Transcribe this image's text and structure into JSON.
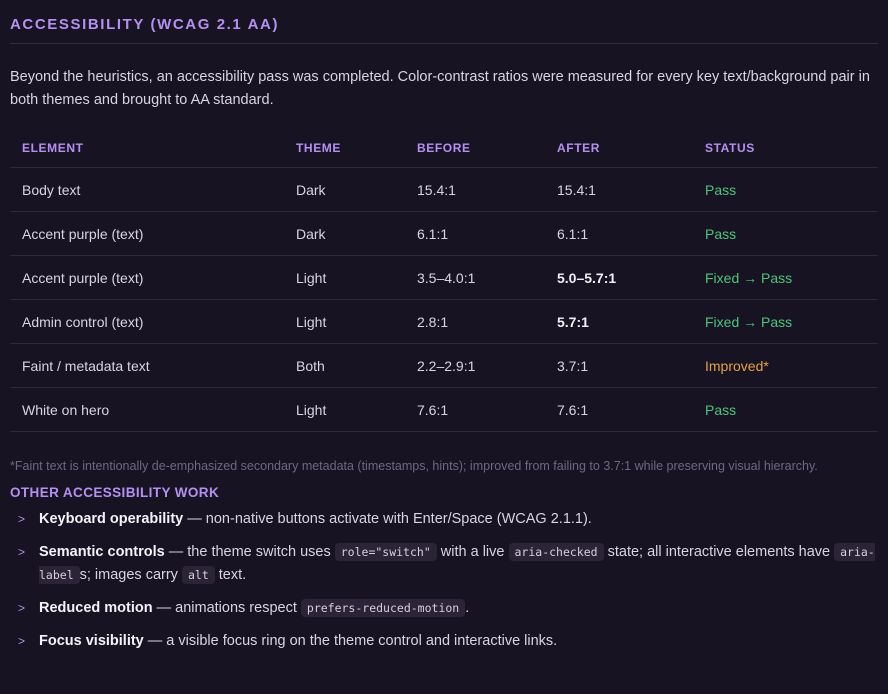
{
  "section_title": "ACCESSIBILITY (WCAG 2.1 AA)",
  "intro": "Beyond the heuristics, an accessibility pass was completed. Color-contrast ratios were measured for every key text/background pair in both themes and brought to AA standard.",
  "table": {
    "headers": [
      "ELEMENT",
      "THEME",
      "BEFORE",
      "AFTER",
      "STATUS"
    ],
    "rows": [
      {
        "element": "Body text",
        "theme": "Dark",
        "before": "15.4:1",
        "after": "15.4:1",
        "status": "Pass",
        "kind": "pass",
        "after_bold": false
      },
      {
        "element": "Accent purple (text)",
        "theme": "Dark",
        "before": "6.1:1",
        "after": "6.1:1",
        "status": "Pass",
        "kind": "pass",
        "after_bold": false
      },
      {
        "element": "Accent purple (text)",
        "theme": "Light",
        "before": "3.5–4.0:1",
        "after": "5.0–5.7:1",
        "status": "Fixed → Pass",
        "kind": "pass",
        "after_bold": true
      },
      {
        "element": "Admin control (text)",
        "theme": "Light",
        "before": "2.8:1",
        "after": "5.7:1",
        "status": "Fixed → Pass",
        "kind": "pass",
        "after_bold": true
      },
      {
        "element": "Faint / metadata text",
        "theme": "Both",
        "before": "2.2–2.9:1",
        "after": "3.7:1",
        "status": "Improved*",
        "kind": "warn",
        "after_bold": false
      },
      {
        "element": "White on hero",
        "theme": "Light",
        "before": "7.6:1",
        "after": "7.6:1",
        "status": "Pass",
        "kind": "pass",
        "after_bold": false
      }
    ]
  },
  "footnote": "*Faint text is intentionally de-emphasized secondary metadata (timestamps, hints); improved from failing to 3.7:1 while preserving visual hierarchy.",
  "other_title": "OTHER ACCESSIBILITY WORK",
  "items": {
    "keyboard": {
      "title": "Keyboard operability",
      "text": " — non-native buttons activate with Enter/Space (WCAG 2.1.1)."
    },
    "semantic": {
      "title": "Semantic controls",
      "t1": " — the theme switch uses ",
      "c1": "role=\"switch\"",
      "t2": " with a live ",
      "c2": "aria-checked",
      "t3": " state; all interactive elements have ",
      "c3": "aria-label",
      "t4": "s; images carry ",
      "c4": "alt",
      "t5": " text."
    },
    "motion": {
      "title": "Reduced motion",
      "t1": " — animations respect ",
      "c1": "prefers-reduced-motion",
      "t2": "."
    },
    "focus": {
      "title": "Focus visibility",
      "text": " — a visible focus ring on the theme control and interactive links."
    }
  },
  "colors": {
    "accent": "#b491f0",
    "pass": "#4cc57c",
    "warn": "#e3a24a",
    "background": "#181322"
  }
}
